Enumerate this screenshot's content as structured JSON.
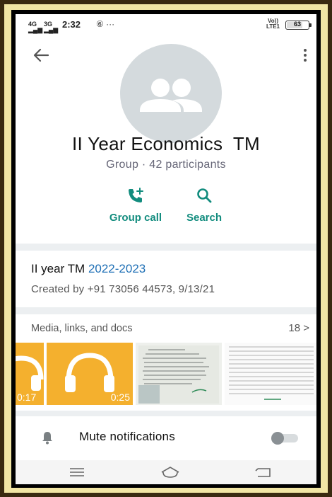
{
  "status_bar": {
    "signal_1_label": "4G",
    "signal_2_label": "3G",
    "time": "2:32",
    "extra_icons": "⑥ ···",
    "network_top": "Vo))",
    "network_bottom": "LTE1",
    "battery_level": "63"
  },
  "group": {
    "name": "II Year Economics  TM",
    "subtitle": "Group · 42 participants"
  },
  "actions": {
    "call_label": "Group call",
    "search_label": "Search"
  },
  "description": {
    "title_prefix": "II year TM ",
    "title_years": "2022-2023",
    "created_by": "Created by +91 73056 44573, 9/13/21"
  },
  "media": {
    "header": "Media, links, and docs",
    "count": "18 >",
    "items": [
      {
        "type": "audio",
        "duration": "0:17"
      },
      {
        "type": "audio",
        "duration": "0:25"
      },
      {
        "type": "document"
      },
      {
        "type": "spreadsheet"
      }
    ]
  },
  "mute": {
    "label": "Mute notifications",
    "enabled": false
  },
  "colors": {
    "accent": "#128c7e",
    "link": "#1e6fb5",
    "audio_thumb": "#f4b02e",
    "frame_gold": "#f2e6a4"
  },
  "icons": [
    "back-arrow-icon",
    "more-vert-icon",
    "group-avatar-icon",
    "add-call-icon",
    "search-icon",
    "headphones-icon",
    "bell-icon",
    "menu-lines-icon",
    "home-icon",
    "back-nav-icon"
  ]
}
